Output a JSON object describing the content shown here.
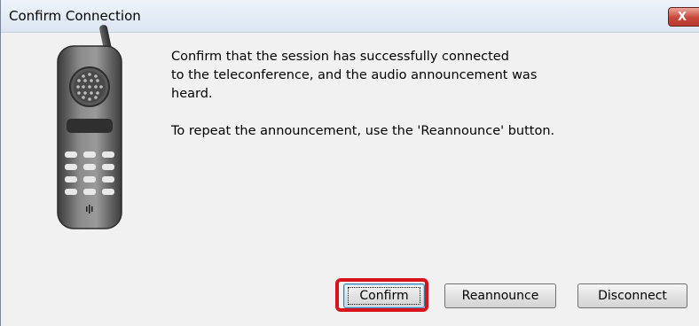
{
  "window": {
    "title": "Confirm Connection",
    "close_label": "X"
  },
  "message": {
    "line1": "Confirm that the session has successfully connected",
    "line2": "to the teleconference, and the audio announcement was",
    "line3": "heard.",
    "line4": "To repeat the announcement, use the 'Reannounce' button."
  },
  "buttons": {
    "confirm": "Confirm",
    "reannounce": "Reannounce",
    "disconnect": "Disconnect"
  },
  "icons": {
    "phone": "mobile-phone-icon"
  },
  "colors": {
    "highlight": "#d8141a",
    "close_button": "#c9463b",
    "titlebar": "#dbe6f3"
  }
}
